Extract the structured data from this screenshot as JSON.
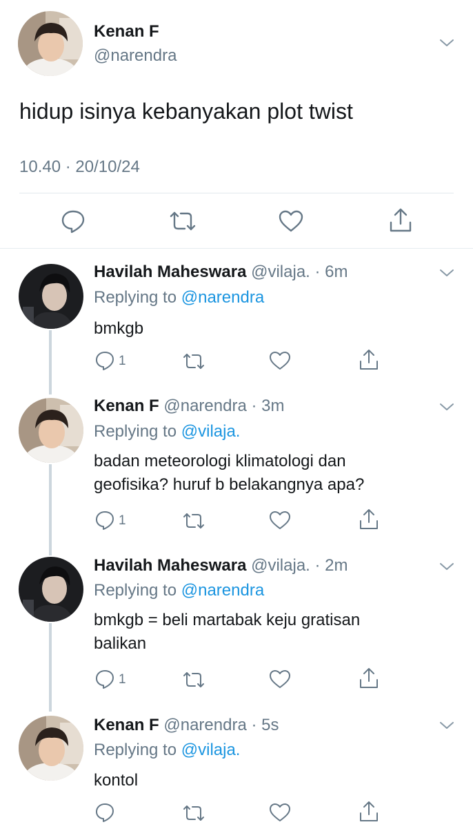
{
  "main_tweet": {
    "name": "Kenan F",
    "handle": "@narendra",
    "text": "hidup isinya kebanyakan plot twist",
    "timestamp": "10.40 · 20/10/24",
    "actions": [
      "reply-icon",
      "retweet-icon",
      "like-icon",
      "share-icon"
    ],
    "avatar": "kenan-avatar"
  },
  "replies": [
    {
      "name": "Havilah Maheswara",
      "handle": "@vilaja. · 6m",
      "replying_label": "Replying to ",
      "replying_to": "@narendra",
      "text": "bmkgb",
      "reply_count": "1",
      "avatar": "havilah-avatar"
    },
    {
      "name": "Kenan F",
      "handle": "@narendra · 3m",
      "replying_label": "Replying to ",
      "replying_to": "@vilaja.",
      "text": "badan meteorologi klimatologi dan\ngeofisika? huruf b belakangnya apa?",
      "reply_count": "1",
      "avatar": "kenan-avatar"
    },
    {
      "name": "Havilah Maheswara",
      "handle": "@vilaja. · 2m",
      "replying_label": "Replying to ",
      "replying_to": "@narendra",
      "text": "bmkgb = beli martabak keju gratisan\nbalikan",
      "reply_count": "1",
      "avatar": "havilah-avatar"
    },
    {
      "name": "Kenan F",
      "handle": "@narendra · 5s",
      "replying_label": "Replying to ",
      "replying_to": "@vilaja.",
      "text": "kontol",
      "reply_count": "",
      "avatar": "kenan-avatar"
    }
  ],
  "colors": {
    "text": "#14171a",
    "secondary": "#657786",
    "link": "#1b95e0",
    "divider": "#e1e8ed",
    "thread_line": "#ccd6dd"
  }
}
